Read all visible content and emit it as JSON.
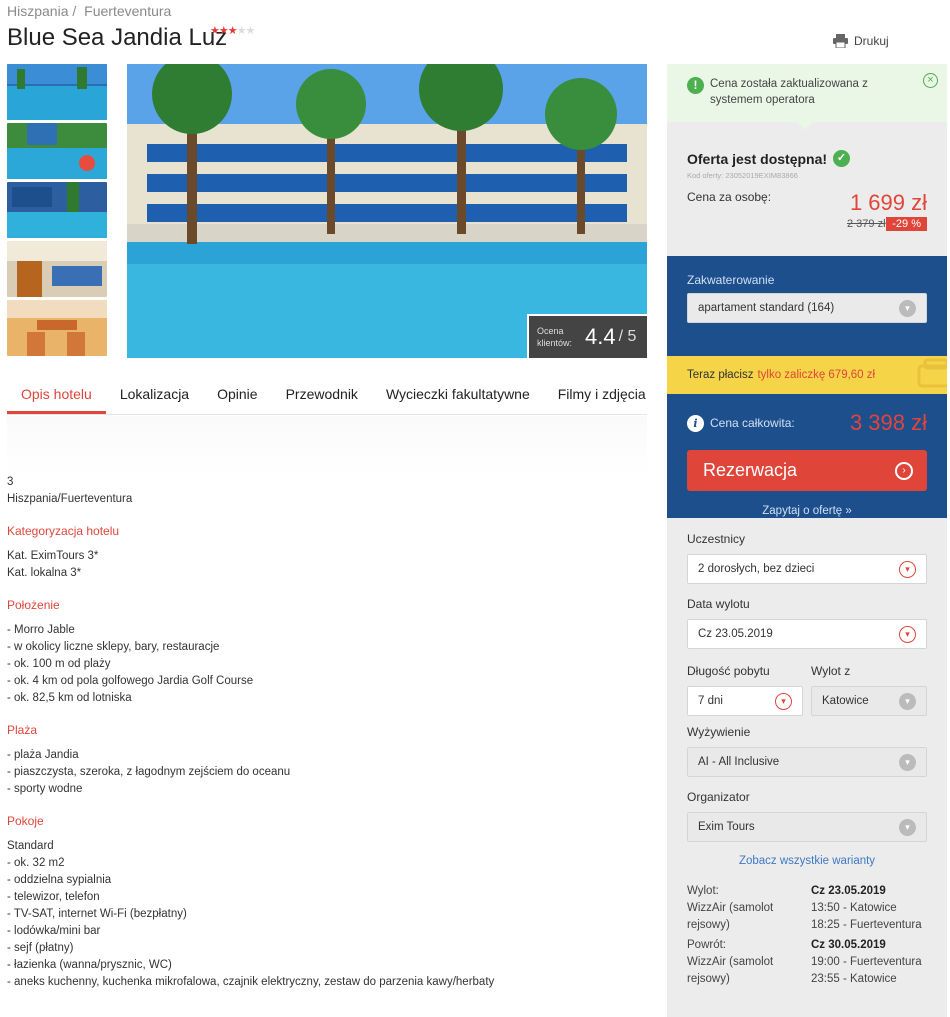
{
  "breadcrumb": [
    "Hiszpania /",
    "Fuerteventura"
  ],
  "hotel": {
    "name": "Blue Sea Jandia Luz",
    "stars": 3,
    "stars_max": 5
  },
  "print_label": "Drukuj",
  "rating": {
    "label_line1": "Ocena",
    "label_line2": "klientów:",
    "value": "4.4",
    "max": "/ 5"
  },
  "tabs": [
    "Opis hotelu",
    "Lokalizacja",
    "Opinie",
    "Przewodnik",
    "Wycieczki fakultatywne",
    "Filmy i zdjęcia"
  ],
  "content": {
    "intro": [
      "3",
      "Hiszpania/Fuerteventura"
    ],
    "sections": [
      {
        "title": "Kategoryzacja hotelu",
        "lines": [
          "Kat. EximTours  3*",
          "Kat. lokalna 3*"
        ]
      },
      {
        "title": "Położenie",
        "lines": [
          "- Morro Jable",
          "- w okolicy liczne sklepy, bary, restauracje",
          "- ok. 100 m od plaży",
          "- ok. 4 km od pola golfowego Jardia Golf Course",
          "- ok. 82,5 km od lotniska"
        ]
      },
      {
        "title": "Plaża",
        "lines": [
          "- plaża Jandia",
          "- piaszczysta, szeroka, z łagodnym zejściem do oceanu",
          "- sporty wodne"
        ]
      },
      {
        "title": "Pokoje",
        "lines": [
          "Standard",
          "- ok. 32 m2",
          "- oddzielna sypialnia",
          "- telewizor,  telefon",
          "- TV-SAT, internet Wi-Fi (bezpłatny)",
          "- lodówka/mini bar",
          "- sejf (płatny)",
          "- łazienka (wanna/prysznic, WC)",
          "- aneks kuchenny, kuchenka mikrofalowa, czajnik elektryczny, zestaw do parzenia kawy/herbaty"
        ]
      }
    ]
  },
  "sidebar": {
    "notice": "Cena została zaktualizowana z systemem operatora",
    "offer_title": "Oferta jest dostępna!",
    "offer_code": "Kod oferty: 23052019EXIM83866",
    "price_label": "Cena za osobę:",
    "price": "1 699 zł",
    "old_price": "2 379 zł",
    "discount": "-29 %",
    "accommodation_label": "Zakwaterowanie",
    "accommodation_value": "apartament standard (164)",
    "deposit_text": "Teraz płacisz",
    "deposit_value": "tylko zaliczkę 679,60 zł",
    "total_label": "Cena całkowita:",
    "total_price": "3 398 zł",
    "reserve_label": "Rezerwacja",
    "ask_label": "Zapytaj o ofertę »",
    "participants_label": "Uczestnicy",
    "participants_value": "2 dorosłych, bez dzieci",
    "departure_date_label": "Data wylotu",
    "departure_date_value": "Cz 23.05.2019",
    "duration_label": "Długość pobytu",
    "duration_value": "7 dni",
    "from_label": "Wylot z",
    "from_value": "Katowice",
    "board_label": "Wyżywienie",
    "board_value": "AI - All Inclusive",
    "organizer_label": "Organizator",
    "organizer_value": "Exim Tours",
    "see_all": "Zobacz wszystkie warianty",
    "outbound": {
      "label": "Wylot:",
      "carrier": "WizzAir (samolot rejsowy)",
      "date": "Cz 23.05.2019",
      "dep": "13:50 - Katowice",
      "arr": "18:25 - Fuerteventura"
    },
    "return": {
      "label": "Powrót:",
      "carrier": "WizzAir (samolot rejsowy)",
      "date": "Cz 30.05.2019",
      "dep": "19:00 - Fuerteventura",
      "arr": "23:55 - Katowice"
    }
  },
  "colors": {
    "accent": "#e0453a",
    "navy": "#1d4f8c",
    "success": "#4caf50",
    "deposit_bg": "#f5d547"
  }
}
